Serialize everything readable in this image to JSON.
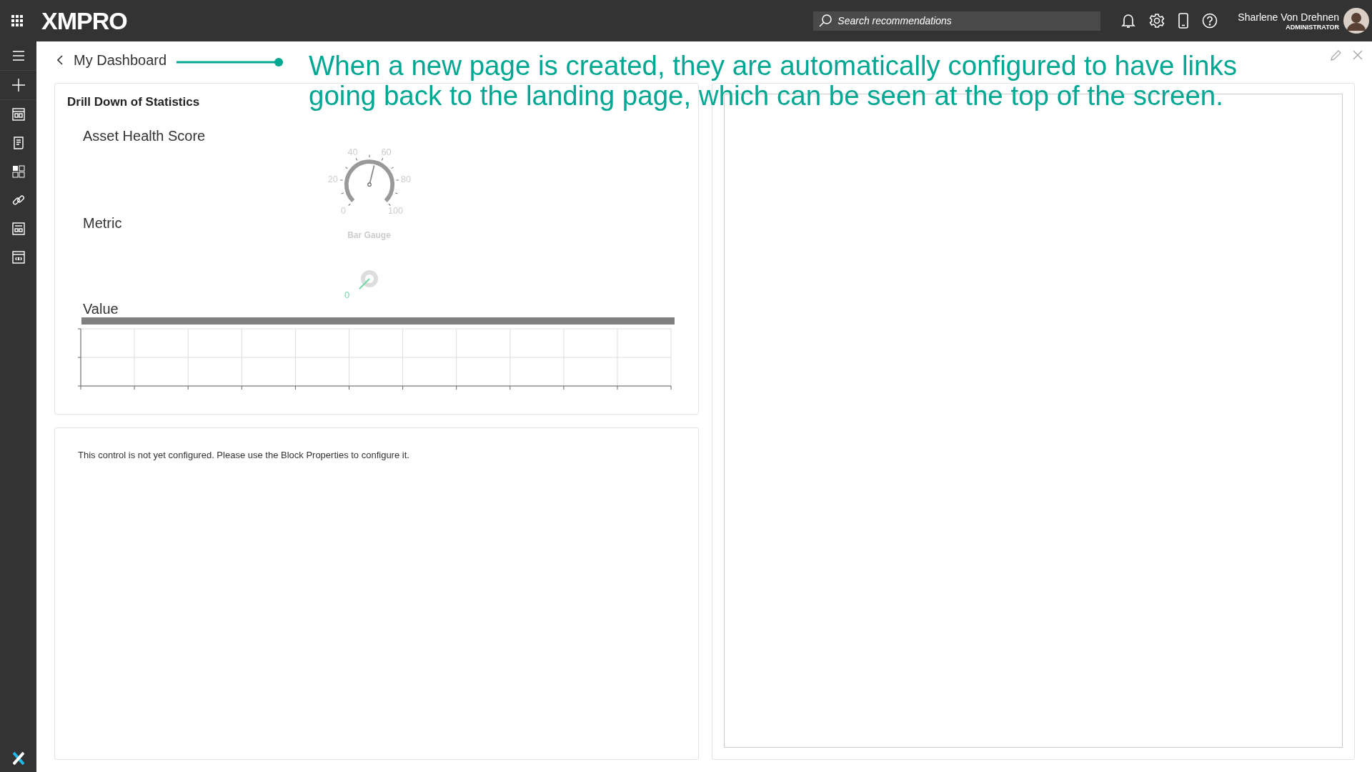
{
  "top_bar": {
    "logo": "XMPRO",
    "search": {
      "placeholder": "Search recommendations"
    },
    "user": {
      "name": "Sharlene Von Drehnen",
      "role": "ADMINISTRATOR"
    }
  },
  "breadcrumb": {
    "back_label": "My Dashboard"
  },
  "annotation": {
    "text": "When a new page is created, they are automatically configured to have links going back to the landing page, which can be seen at the top of the screen."
  },
  "cards": [
    {
      "kind": "statistics",
      "title": "Drill Down of Statistics",
      "labels": [
        "Asset Health Score",
        "Metric",
        "Value"
      ],
      "gauge": {
        "title": "Bar Gauge",
        "ticks": [
          "0",
          "20",
          "40",
          "60",
          "80",
          "100"
        ]
      },
      "small_gauge": {
        "value": "0"
      }
    },
    {
      "kind": "message",
      "message": "This control is not yet configured. Please use the Block Properties to configure it."
    },
    {
      "kind": "empty"
    }
  ]
}
